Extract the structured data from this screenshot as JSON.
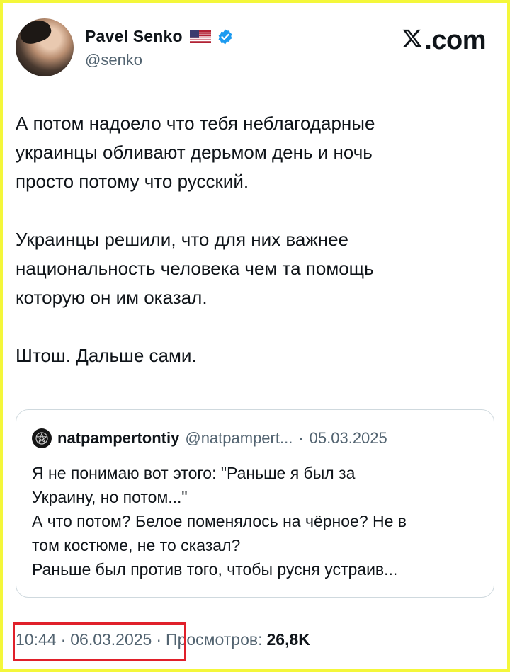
{
  "author": {
    "display_name": "Pavel Senko",
    "handle": "@senko",
    "flag_icon": "us-flag-icon",
    "verified_icon": "verified-badge-icon"
  },
  "brand": {
    "text": ".com",
    "logo_icon": "x-logo-icon"
  },
  "tweet": {
    "paragraphs": [
      "А потом надоело что тебя неблагодарные\nукраинцы обливают дерьмом день и ночь\nпросто потому что русский.",
      "Украинцы решили, что для них важнее\nнациональность человека чем та помощь\nкоторую он им оказал.",
      "Штош. Дальше сами."
    ]
  },
  "quote": {
    "display_name": "natpampertontiy",
    "handle": "@natpampert...",
    "separator": "·",
    "date": "05.03.2025",
    "text": "Я не понимаю вот этого: \"Раньше я был за\nУкраину, но потом...\"\nА что потом? Белое поменялось на чёрное? Не в\nтом костюме, не то сказал?\nРаньше был против того, чтобы русня устраив..."
  },
  "footer": {
    "time": "10:44",
    "separator": "·",
    "date": "06.03.2025",
    "views_label": "Просмотров:",
    "views_count": "26,8K"
  },
  "colors": {
    "highlight": "#e0202a",
    "frame": "#f4f73a",
    "verified": "#1d9bf0"
  }
}
